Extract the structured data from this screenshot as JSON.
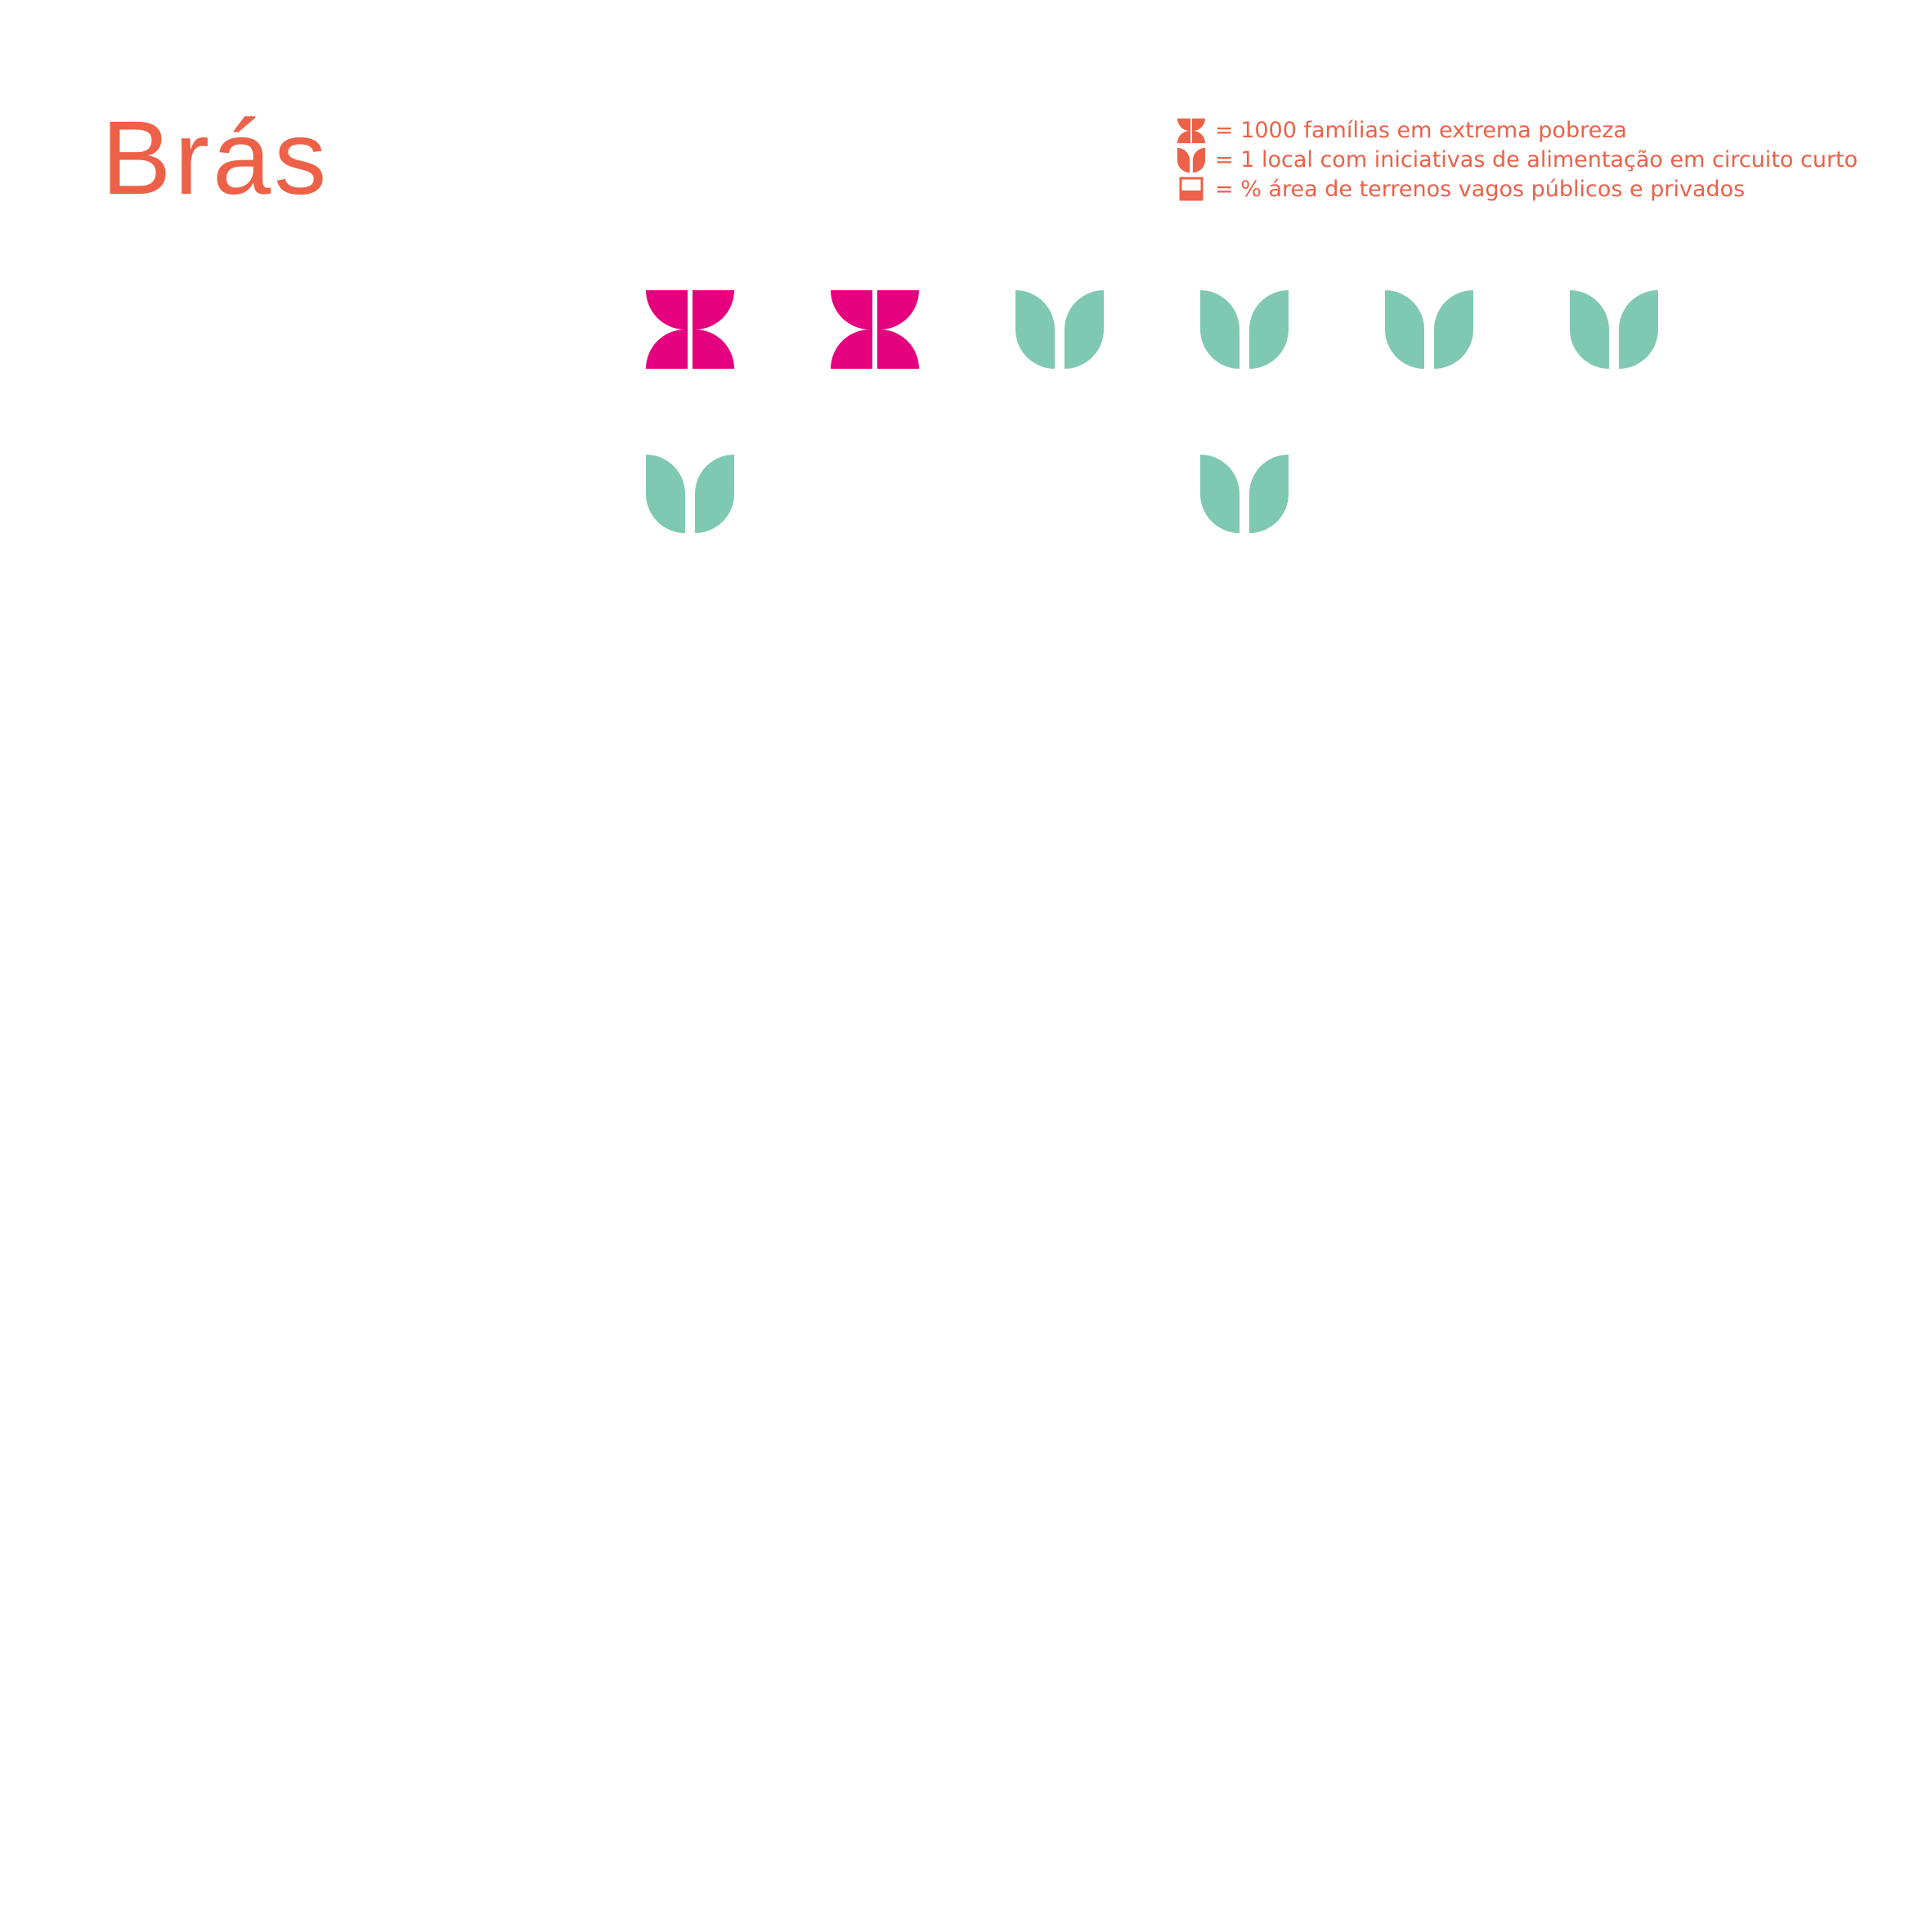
{
  "title": "Brás",
  "colors": {
    "accent": "#ec6148",
    "poverty": "#e4007f",
    "food": "#7fc8b2"
  },
  "legend": [
    {
      "icon": "poverty-icon",
      "label": "= 1000 famílias em extrema pobreza"
    },
    {
      "icon": "sprout-icon",
      "label": "= 1 local com iniciativas de alimentação em circuito curto"
    },
    {
      "icon": "vacant-land-icon",
      "label": "= % área de terrenos vagos públicos e privados"
    }
  ],
  "icons": {
    "poverty_count": 2,
    "food_count": 6
  }
}
